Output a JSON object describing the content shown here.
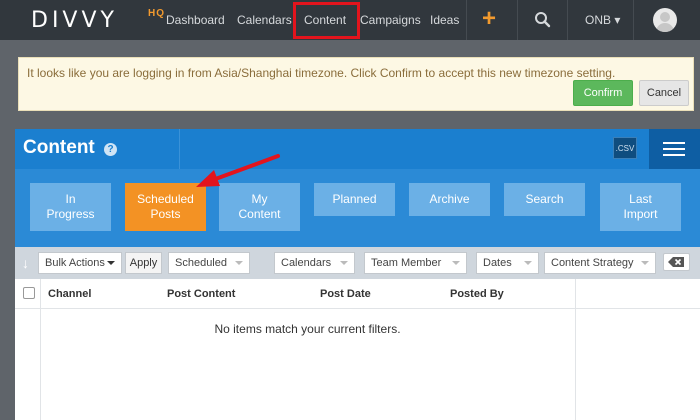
{
  "app": {
    "logo_text": "DIVVY",
    "logo_suffix": "HQ"
  },
  "nav": {
    "items": [
      {
        "label": "Dashboard"
      },
      {
        "label": "Calendars"
      },
      {
        "label": "Content"
      },
      {
        "label": "Campaigns"
      },
      {
        "label": "Ideas"
      }
    ],
    "add_icon": "plus-icon",
    "search_icon": "search-icon",
    "org_label": "ONB",
    "org_caret": "▾"
  },
  "notice": {
    "text": "It looks like you are logging in from Asia/Shanghai timezone. Click Confirm to accept this new timezone setting.",
    "confirm_label": "Confirm",
    "cancel_label": "Cancel"
  },
  "content": {
    "title": "Content",
    "help_glyph": "?",
    "csv_label": ".CSV",
    "tabs": [
      {
        "line1": "In",
        "line2": "Progress"
      },
      {
        "line1": "Scheduled",
        "line2": "Posts"
      },
      {
        "line1": "My",
        "line2": "Content"
      },
      {
        "line1": "Planned",
        "line2": ""
      },
      {
        "line1": "Archive",
        "line2": ""
      },
      {
        "line1": "Search",
        "line2": ""
      },
      {
        "line1": "Last",
        "line2": "Import"
      }
    ],
    "active_tab": "Scheduled Posts"
  },
  "toolbar": {
    "bulk_actions": "Bulk Actions",
    "apply_label": "Apply",
    "filters": [
      "Scheduled",
      "Calendars",
      "Team Member",
      "Dates",
      "Content Strategy"
    ]
  },
  "table": {
    "columns": [
      "Channel",
      "Post Content",
      "Post Date",
      "Posted By"
    ],
    "empty_message": "No items match your current filters."
  },
  "colors": {
    "nav_bg": "#31373d",
    "accent_orange": "#f39224",
    "brand_blue": "#1b7fcf",
    "highlight_red": "#e3141d"
  }
}
